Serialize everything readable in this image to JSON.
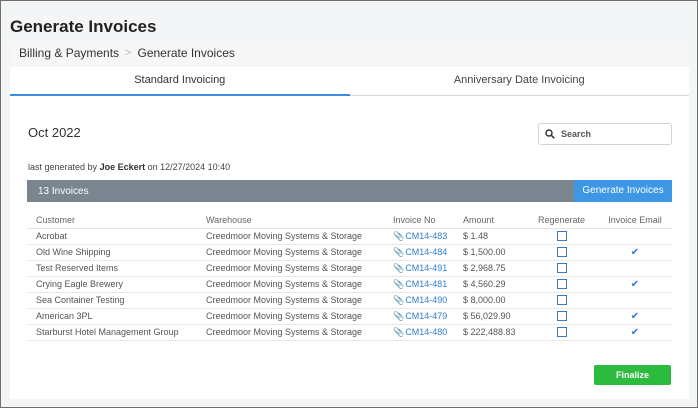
{
  "page": {
    "title": "Generate Invoices"
  },
  "breadcrumb": {
    "items": [
      "Billing & Payments",
      "Generate Invoices"
    ],
    "separator": ">"
  },
  "tabs": [
    {
      "label": "Standard Invoicing",
      "active": true
    },
    {
      "label": "Anniversary Date Invoicing",
      "active": false
    }
  ],
  "period": "Oct 2022",
  "search": {
    "placeholder": "Search",
    "value": "",
    "icon": "search-icon"
  },
  "last_generated": {
    "prefix": "last generated by",
    "user": "Joe Eckert",
    "suffix": "on 12/27/2024 10:40"
  },
  "invoice_bar": {
    "count_label": "13 Invoices",
    "generate_label": "Generate Invoices"
  },
  "table": {
    "headers": {
      "customer": "Customer",
      "warehouse": "Warehouse",
      "invoice_no": "Invoice No",
      "amount": "Amount",
      "regenerate": "Regenerate",
      "invoice_email": "Invoice Email"
    },
    "rows": [
      {
        "customer": "Acrobat",
        "warehouse": "Creedmoor Moving Systems & Storage",
        "invoice_no": "CM14-483",
        "amount": "$ 1.48",
        "regenerate": false,
        "email": false
      },
      {
        "customer": "Old Wine Shipping",
        "warehouse": "Creedmoor Moving Systems & Storage",
        "invoice_no": "CM14-484",
        "amount": "$ 1,500.00",
        "regenerate": false,
        "email": true
      },
      {
        "customer": "Test Reserved Items",
        "warehouse": "Creedmoor Moving Systems & Storage",
        "invoice_no": "CM14-491",
        "amount": "$ 2,968.75",
        "regenerate": false,
        "email": false
      },
      {
        "customer": "Crying Eagle Brewery",
        "warehouse": "Creedmoor Moving Systems & Storage",
        "invoice_no": "CM14-481",
        "amount": "$ 4,560.29",
        "regenerate": false,
        "email": true
      },
      {
        "customer": "Sea Container Testing",
        "warehouse": "Creedmoor Moving Systems & Storage",
        "invoice_no": "CM14-490",
        "amount": "$ 8,000.00",
        "regenerate": false,
        "email": false
      },
      {
        "customer": "American 3PL",
        "warehouse": "Creedmoor Moving Systems & Storage",
        "invoice_no": "CM14-479",
        "amount": "$ 56,029.90",
        "regenerate": false,
        "email": true
      },
      {
        "customer": "Starburst Hotel Management Group",
        "warehouse": "Creedmoor Moving Systems & Storage",
        "invoice_no": "CM14-480",
        "amount": "$ 222,488.83",
        "regenerate": false,
        "email": true
      }
    ]
  },
  "finalize_label": "Finalize",
  "colors": {
    "accent": "#3d97e4",
    "bar": "#7a8590",
    "finalize": "#2dbb3f",
    "link": "#2f7fd0"
  }
}
